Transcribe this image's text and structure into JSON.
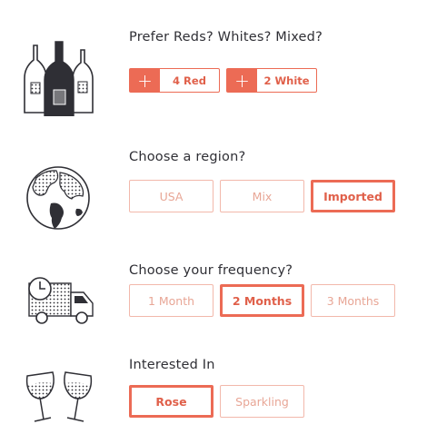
{
  "sections": {
    "wine_type": {
      "title": "Prefer Reds? Whites? Mixed?",
      "counters": [
        {
          "label": "4 Red",
          "icon": "plus-icon"
        },
        {
          "label": "2 White",
          "icon": "plus-icon"
        }
      ]
    },
    "region": {
      "title": "Choose a region?",
      "options": [
        {
          "label": "USA",
          "selected": false
        },
        {
          "label": "Mix",
          "selected": false
        },
        {
          "label": "Imported",
          "selected": true
        }
      ]
    },
    "frequency": {
      "title": "Choose your frequency?",
      "options": [
        {
          "label": "1 Month",
          "selected": false
        },
        {
          "label": "2 Months",
          "selected": true
        },
        {
          "label": "3 Months",
          "selected": false
        }
      ]
    },
    "interest": {
      "title": "Interested In",
      "options": [
        {
          "label": "Rose",
          "selected": true
        },
        {
          "label": "Sparkling",
          "selected": false
        }
      ]
    }
  },
  "icons": [
    "wine-bottles-icon",
    "globe-icon",
    "delivery-truck-icon",
    "wine-glasses-toast-icon"
  ],
  "colors": {
    "accent": "#ec6b55",
    "accent_light": "#f2b8ab",
    "text": "#2f2f35"
  }
}
